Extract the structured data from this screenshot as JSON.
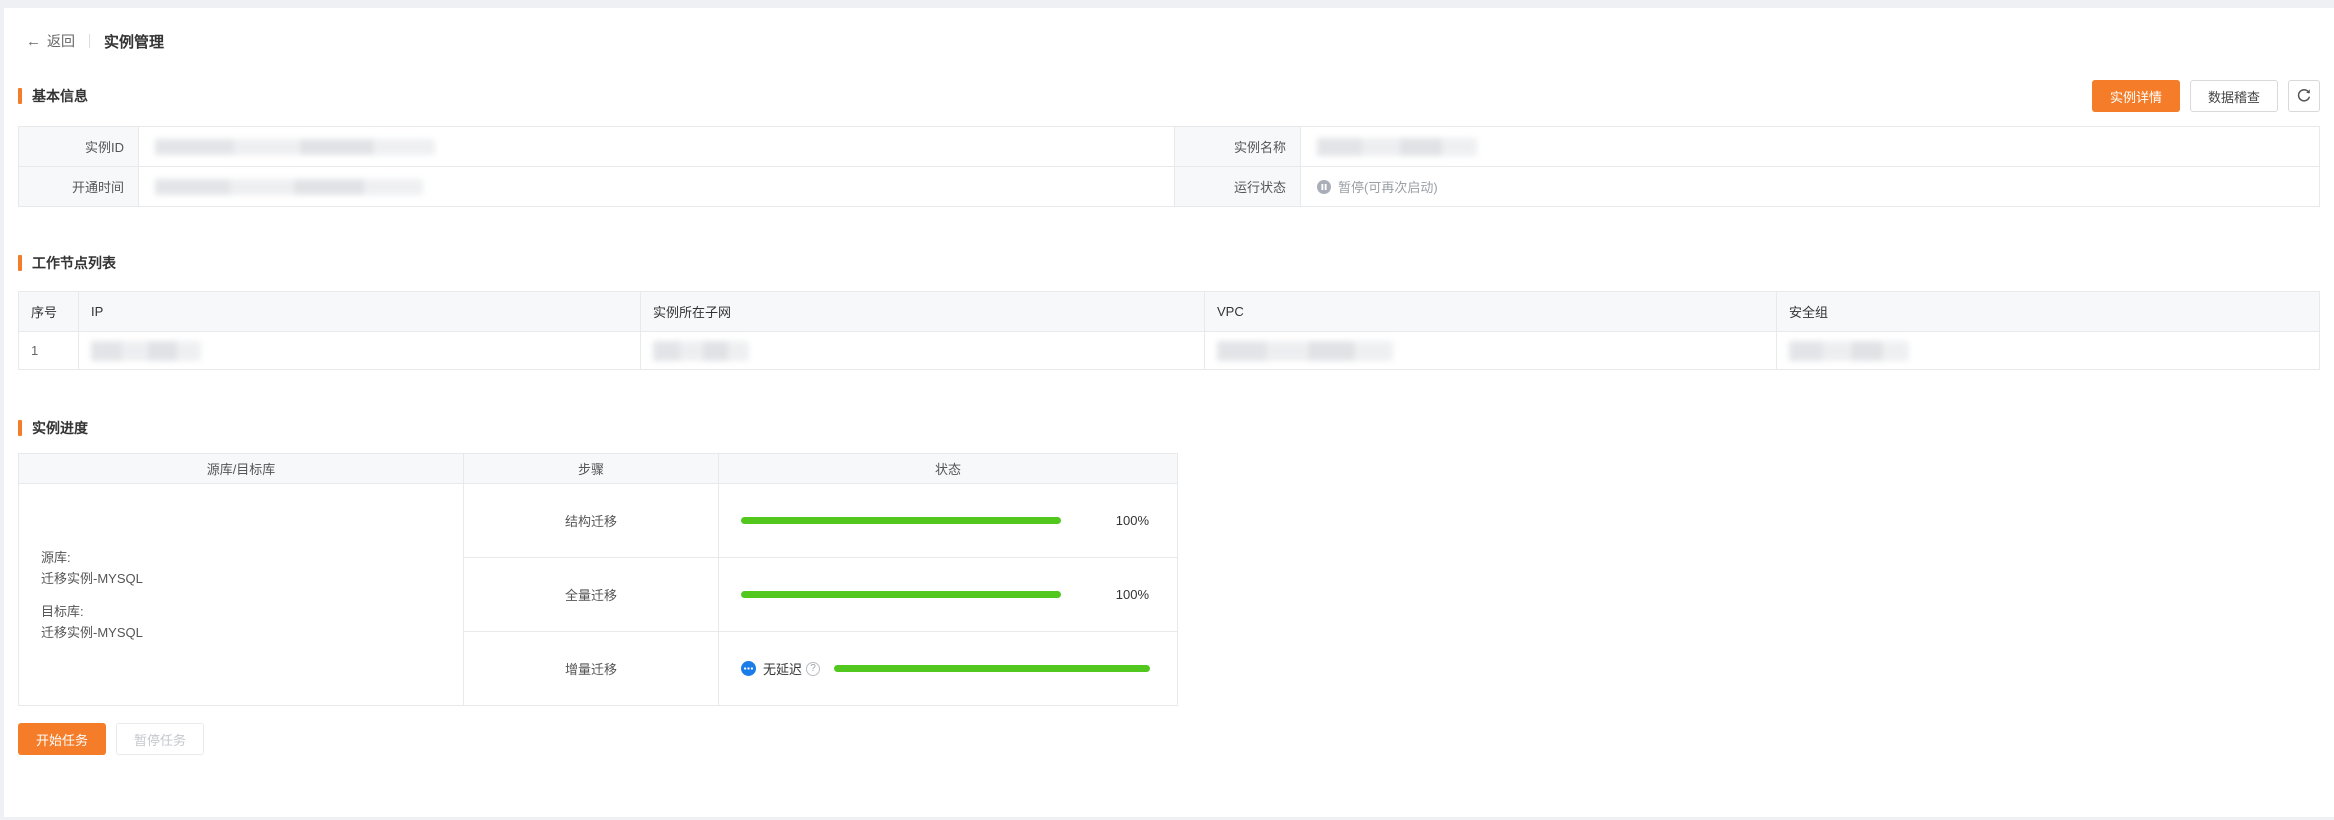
{
  "topnav": {
    "back": "返回",
    "title": "实例管理"
  },
  "basic_info": {
    "title": "基本信息",
    "buttons": {
      "detail": "实例详情",
      "audit": "数据稽查"
    },
    "labels": {
      "instance_id": "实例ID",
      "instance_name": "实例名称",
      "open_time": "开通时间",
      "run_status": "运行状态"
    },
    "run_status_value": "暂停(可再次启动)"
  },
  "worker_nodes": {
    "title": "工作节点列表",
    "columns": [
      "序号",
      "IP",
      "实例所在子网",
      "VPC",
      "安全组"
    ],
    "rows": [
      {
        "index": "1"
      }
    ]
  },
  "progress": {
    "title": "实例进度",
    "columns": [
      "源库/目标库",
      "步骤",
      "状态"
    ],
    "db": {
      "source_label": "源库:",
      "source_value": "迁移实例-MYSQL",
      "target_label": "目标库:",
      "target_value": "迁移实例-MYSQL"
    },
    "steps": [
      {
        "name": "结构迁移",
        "percent": "100%",
        "progress": 100
      },
      {
        "name": "全量迁移",
        "percent": "100%",
        "progress": 100
      },
      {
        "name": "增量迁移",
        "delay_text": "无延迟",
        "progress": 100
      }
    ]
  },
  "task_buttons": {
    "start": "开始任务",
    "pause": "暂停任务"
  },
  "colors": {
    "accent": "#f57d2a",
    "green": "#52c81e",
    "blue": "#1a7ce8"
  }
}
